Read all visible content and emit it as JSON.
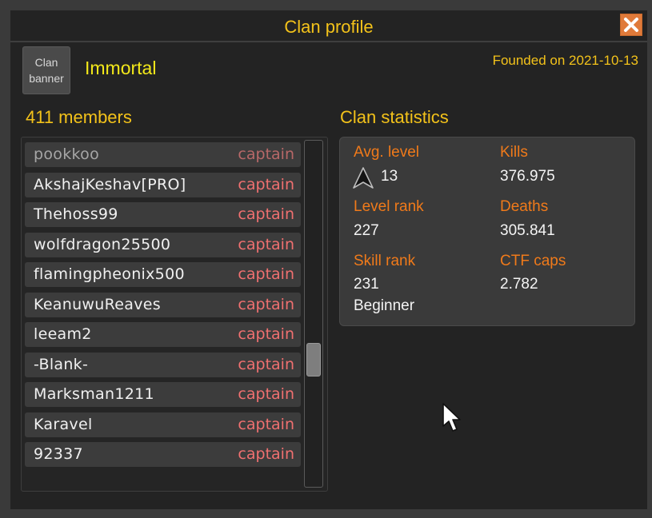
{
  "window": {
    "title": "Clan profile"
  },
  "clan": {
    "banner_label": "Clan banner",
    "name": "Immortal",
    "founded": "Founded on 2021-10-13"
  },
  "members": {
    "heading": "411 members",
    "list": [
      {
        "name": "pookkoo",
        "rank": "captain"
      },
      {
        "name": "AkshajKeshav[PRO]",
        "rank": "captain"
      },
      {
        "name": "Thehoss99",
        "rank": "captain"
      },
      {
        "name": "wolfdragon25500",
        "rank": "captain"
      },
      {
        "name": "flamingpheonix500",
        "rank": "captain"
      },
      {
        "name": "KeanuwuReaves",
        "rank": "captain"
      },
      {
        "name": "leeam2",
        "rank": "captain"
      },
      {
        "name": "-Blank-",
        "rank": "captain"
      },
      {
        "name": "Marksman1211",
        "rank": "captain"
      },
      {
        "name": "Karavel",
        "rank": "captain"
      },
      {
        "name": "92337",
        "rank": "captain"
      }
    ]
  },
  "stats": {
    "heading": "Clan statistics",
    "avg_level": {
      "label": "Avg. level",
      "value": "13",
      "icon": "level-chevron-icon"
    },
    "kills": {
      "label": "Kills",
      "value": "376.975"
    },
    "level_rank": {
      "label": "Level rank",
      "value": "227"
    },
    "deaths": {
      "label": "Deaths",
      "value": "305.841"
    },
    "skill_rank": {
      "label": "Skill rank",
      "value": "231",
      "tier": "Beginner"
    },
    "ctf_caps": {
      "label": "CTF caps",
      "value": "2.782"
    }
  },
  "colors": {
    "title": "#f3c21a",
    "clan_name": "#f3e81a",
    "stat_label": "#f07a1a",
    "rank": "#f07070",
    "close_button": "#e07a3a"
  }
}
